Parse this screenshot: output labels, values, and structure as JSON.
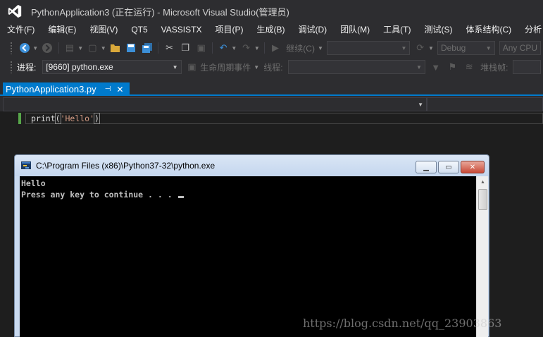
{
  "window": {
    "title": "PythonApplication3 (正在运行) - Microsoft Visual Studio(管理员)"
  },
  "menu": {
    "items": [
      "文件(F)",
      "编辑(E)",
      "视图(V)",
      "QT5",
      "VASSISTX",
      "项目(P)",
      "生成(B)",
      "调试(D)",
      "团队(M)",
      "工具(T)",
      "测试(S)",
      "体系结构(C)",
      "分析"
    ]
  },
  "toolbar": {
    "continue_label": "继续(C)",
    "config_value": "Debug",
    "platform_value": "Any CPU",
    "process_label": "进程:",
    "process_value": "[9660] python.exe",
    "lifecycle_label": "生命周期事件",
    "thread_label": "线程:",
    "stackframe_label": "堆栈帧:"
  },
  "tab": {
    "label": "PythonApplication3.py",
    "pin_icon": "pin-icon",
    "close_icon": "close-icon"
  },
  "editor": {
    "code_fn": "print",
    "code_open": "(",
    "code_str": "'Hello'",
    "code_close": ")"
  },
  "console": {
    "title": "C:\\Program Files (x86)\\Python37-32\\python.exe",
    "line1": "Hello",
    "line2": "Press any key to continue . . . "
  },
  "watermark": {
    "text": "https://blog.csdn.net/qq_23903863"
  },
  "colors": {
    "accent": "#007acc",
    "background": "#2d2d30",
    "editor_bg": "#1e1e1e"
  }
}
